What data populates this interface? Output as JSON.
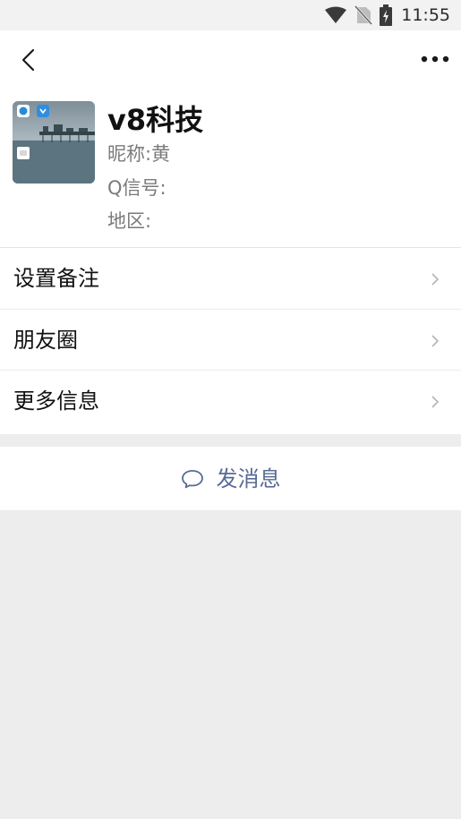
{
  "status_bar": {
    "time": "11:55",
    "icons": [
      "wifi-icon",
      "no-sim-icon",
      "battery-charging-icon"
    ]
  },
  "header": {
    "back_icon": "back-arrow-icon",
    "more_icon": "more-icon"
  },
  "profile": {
    "name": "v8科技",
    "nickname": "昵称:黄",
    "qq": "Q信号:",
    "region": "地区:"
  },
  "menu": {
    "items": [
      {
        "label": "设置备注"
      },
      {
        "label": "朋友圈"
      },
      {
        "label": "更多信息"
      }
    ]
  },
  "actions": {
    "send_message": "发消息",
    "send_icon": "chat-bubble-icon"
  },
  "colors": {
    "background": "#ededed",
    "link": "#576b95",
    "text": "#111111",
    "secondary_text": "#7a7a7a"
  }
}
